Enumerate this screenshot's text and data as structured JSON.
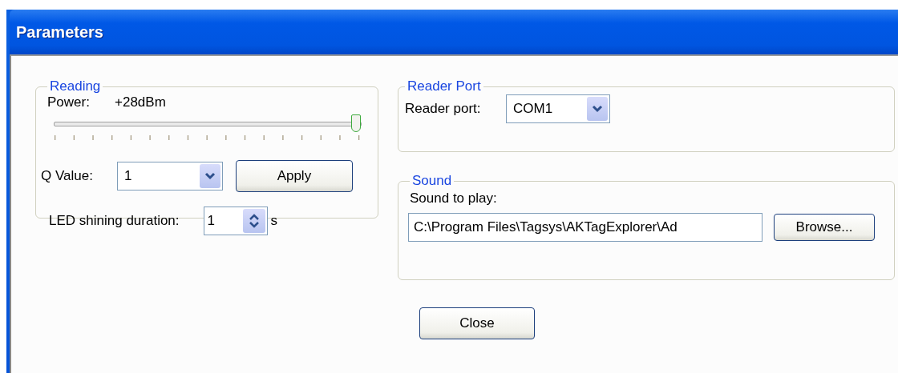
{
  "window": {
    "title": "Parameters"
  },
  "reading": {
    "title": "Reading",
    "power_label": "Power:",
    "power_value": "+28dBm",
    "power_slider": {
      "level": 1.0
    },
    "q_label": "Q Value:",
    "q_value": "1",
    "apply_button": "Apply",
    "led_label": "LED shining duration:",
    "led_value": "1",
    "led_unit": "s"
  },
  "reader_port": {
    "title": "Reader Port",
    "label": "Reader port:",
    "value": "COM1"
  },
  "sound": {
    "title": "Sound",
    "label": "Sound to play:",
    "value": "C:\\Program Files\\Tagsys\\AKTagExplorer\\Ad",
    "browse_button": "Browse..."
  },
  "buttons": [
    "Close"
  ]
}
